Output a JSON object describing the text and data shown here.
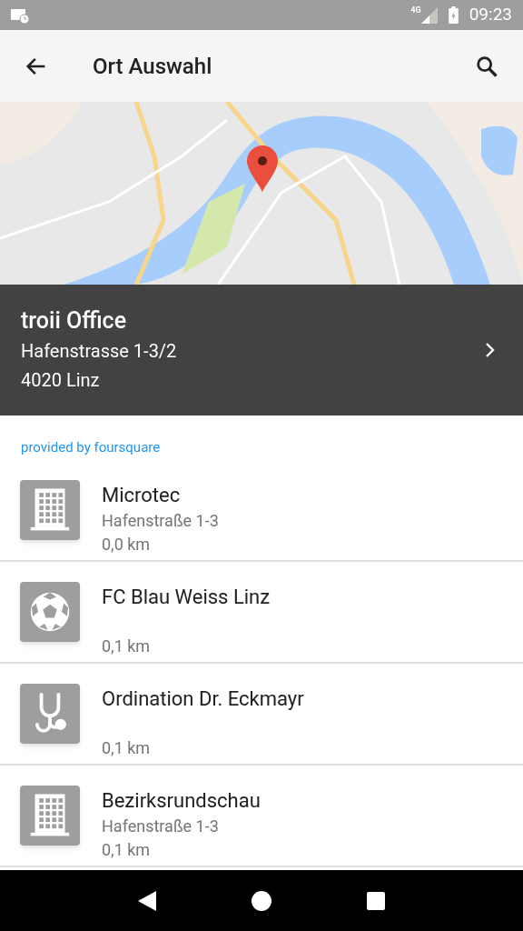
{
  "status_bar": {
    "network": "4G",
    "time": "09:23"
  },
  "app_bar": {
    "title": "Ort Auswahl"
  },
  "selected_place": {
    "name": "troii Office",
    "address_line_1": "Hafenstrasse 1-3/2",
    "address_line_2": "4020 Linz"
  },
  "attribution": "provided by foursquare",
  "places": [
    {
      "kind": "building",
      "name": "Microtec",
      "address": "Hafenstraße 1-3",
      "distance": "0,0 km"
    },
    {
      "kind": "sports",
      "name": "FC Blau Weiss Linz",
      "distance": "0,1 km"
    },
    {
      "kind": "medical",
      "name": "Ordination Dr. Eckmayr",
      "distance": "0,1 km"
    },
    {
      "kind": "building",
      "name": "Bezirksrundschau",
      "address": "Hafenstraße 1-3",
      "distance": "0,1 km"
    }
  ]
}
